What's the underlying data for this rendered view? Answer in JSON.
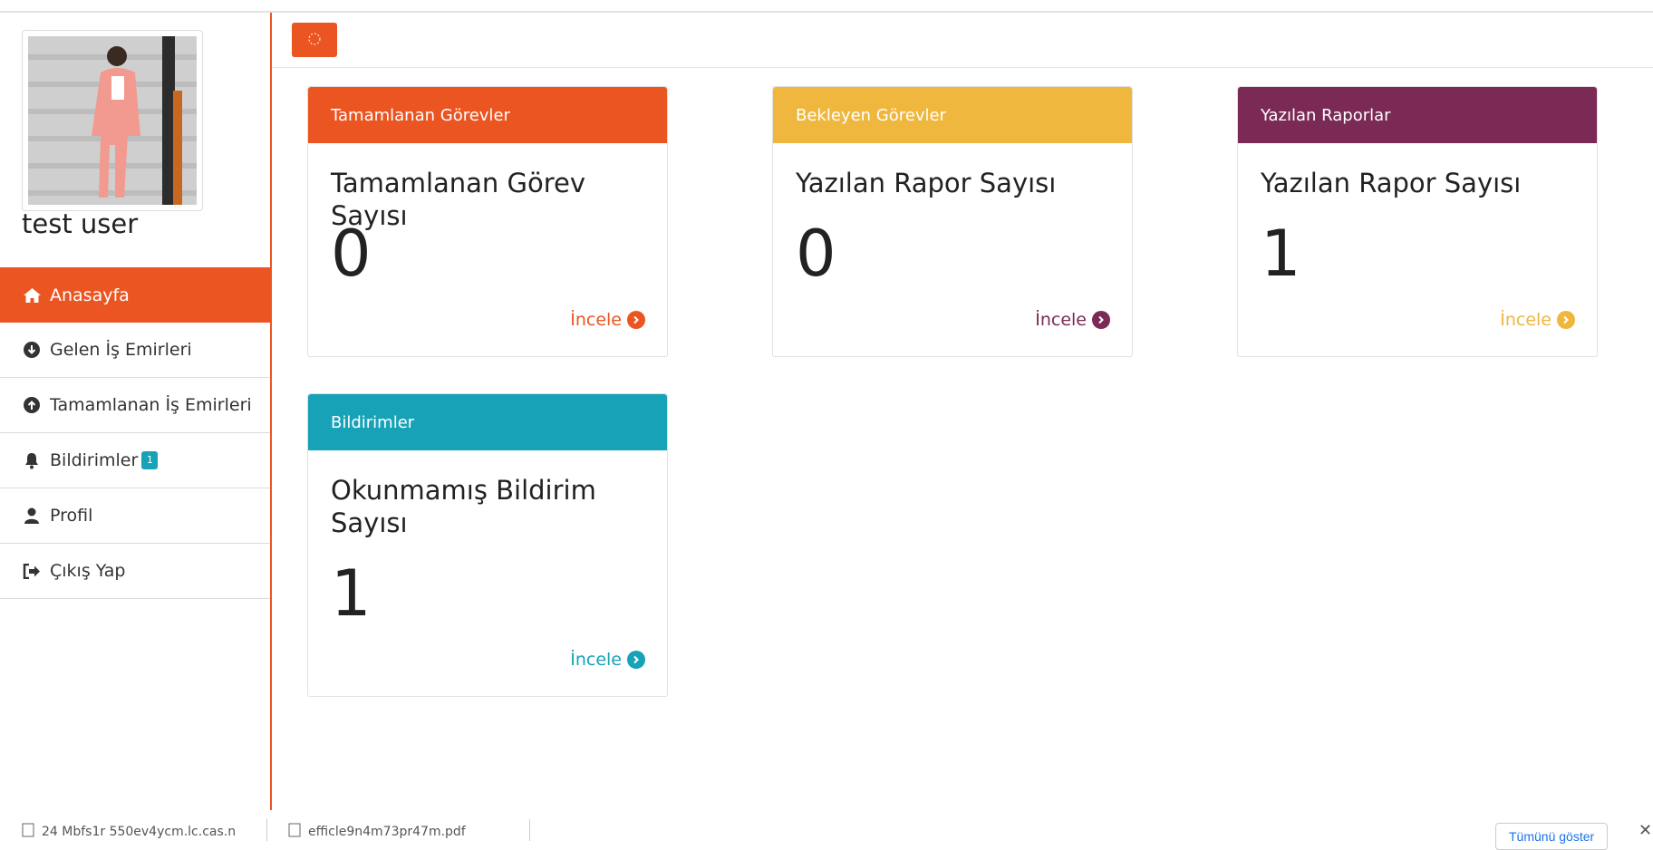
{
  "user": {
    "name": "test user"
  },
  "sidebar": {
    "items": [
      {
        "label": "Anasayfa",
        "icon": "home-icon",
        "active": true
      },
      {
        "label": "Gelen İş Emirleri",
        "icon": "arrow-circle-down-icon"
      },
      {
        "label": "Tamamlanan İş Emirleri",
        "icon": "arrow-circle-up-icon"
      },
      {
        "label": "Bildirimler",
        "icon": "bell-icon",
        "badge": "1"
      },
      {
        "label": "Profil",
        "icon": "user-icon"
      },
      {
        "label": "Çıkış Yap",
        "icon": "sign-out-icon"
      }
    ]
  },
  "colors": {
    "accent": "#eb5522",
    "yellow": "#efb73e",
    "purple": "#7a2a54",
    "teal": "#17a2b8"
  },
  "cards": [
    {
      "header": "Tamamlanan Görevler",
      "title": "Tamamlanan Görev Sayısı",
      "value": "0",
      "link": "İncele"
    },
    {
      "header": "Bekleyen Görevler",
      "title": "Yazılan Rapor Sayısı",
      "value": "0",
      "link": "İncele"
    },
    {
      "header": "Yazılan Raporlar",
      "title": "Yazılan Rapor Sayısı",
      "value": "1",
      "link": "İncele"
    },
    {
      "header": "Bildirimler",
      "title": "Okunmamış Bildirim Sayısı",
      "value": "1",
      "link": "İncele"
    }
  ],
  "downloads": {
    "items": [
      "24 Mbfs1r 550ev4ycm.lc.cas.n",
      "efficle9n4m73pr47m.pdf"
    ],
    "show_all": "Tümünü göster"
  }
}
